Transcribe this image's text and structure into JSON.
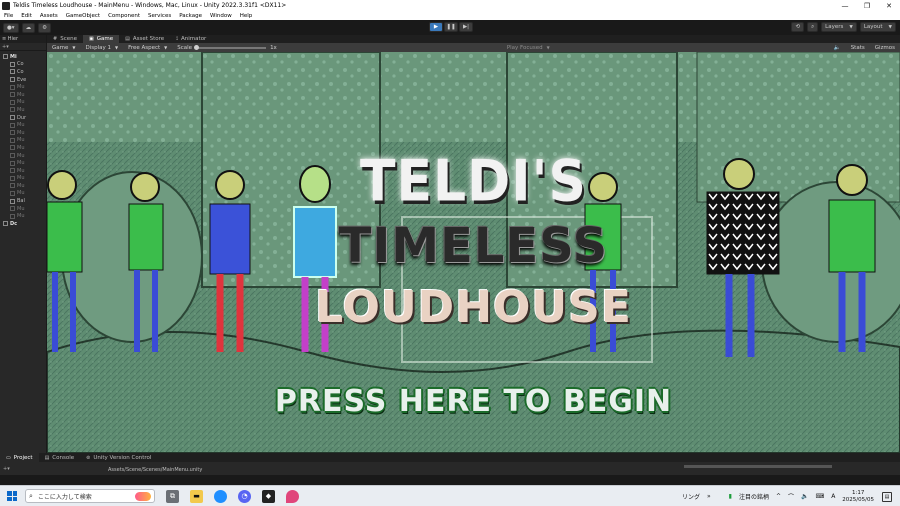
{
  "window": {
    "title": "Teldis Timeless Loudhouse - MainMenu - Windows, Mac, Linux - Unity 2022.3.31f1 <DX11>",
    "minimize_icon": "minimize-icon",
    "maximize_icon": "maximize-icon",
    "close_icon": "close-icon"
  },
  "menu": {
    "items": [
      "File",
      "Edit",
      "Assets",
      "GameObject",
      "Component",
      "Services",
      "Package",
      "Window",
      "Help"
    ]
  },
  "toolbar": {
    "layers_label": "Layers",
    "layout_label": "Layout"
  },
  "hierarchy": {
    "tab_label": "Hier",
    "rows": [
      {
        "label": "Mi",
        "root": true
      },
      {
        "label": "Co"
      },
      {
        "label": "Co"
      },
      {
        "label": "Eve"
      },
      {
        "label": "Mu"
      },
      {
        "label": "Mu"
      },
      {
        "label": "Mu"
      },
      {
        "label": "Mu"
      },
      {
        "label": "Dur"
      },
      {
        "label": "Mu"
      },
      {
        "label": "Mu"
      },
      {
        "label": "Mu"
      },
      {
        "label": "Mu"
      },
      {
        "label": "Mu"
      },
      {
        "label": "Mu"
      },
      {
        "label": "Mu"
      },
      {
        "label": "Mu"
      },
      {
        "label": "Mu"
      },
      {
        "label": "Mu"
      },
      {
        "label": "Bal"
      },
      {
        "label": "Mu"
      },
      {
        "label": "Mu"
      },
      {
        "label": "Dc",
        "root": true
      }
    ]
  },
  "tabs": {
    "scene": "Scene",
    "game": "Game",
    "asset_store": "Asset Store",
    "animator": "Animator"
  },
  "gamebar": {
    "mode": "Game",
    "display": "Display 1",
    "aspect": "Free Aspect",
    "scale_label": "Scale",
    "scale_value": "1x",
    "play_focused": "Play Focused",
    "stats": "Stats",
    "gizmos": "Gizmos"
  },
  "game": {
    "title_line1": "TELDI'S",
    "title_line2": "TIMELESS",
    "title_line3": "LOUDHOUSE",
    "press_label": "PRESS HERE TO BEGIN"
  },
  "bottom": {
    "project_tab": "Project",
    "console_tab": "Console",
    "vcs_tab": "Unity Version Control",
    "path": "Assets/Scene/Scenes/MainMenu.unity"
  },
  "taskbar": {
    "search_placeholder": "ここに入力して検索",
    "tray_item": "リング",
    "news_label": "注目の銘柄",
    "ime_label": "A",
    "time": "1:17",
    "date": "2025/05/05"
  }
}
